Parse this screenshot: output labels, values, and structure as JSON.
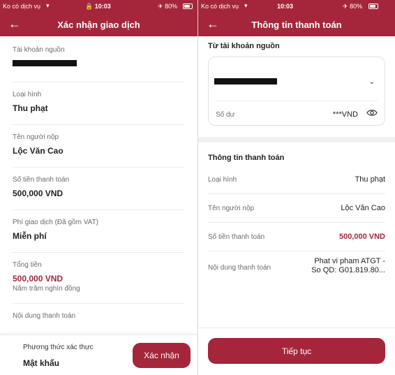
{
  "left": {
    "status": {
      "carrier": "Ko có dịch vụ",
      "time": "10:03",
      "battery": "80%",
      "battery_level": 0.8
    },
    "nav": {
      "title": "Xác nhận giao dịch"
    },
    "fields": [
      {
        "label": "Tài khoản nguồn",
        "masked": true
      },
      {
        "label": "Loại hình",
        "value": "Thu phạt"
      },
      {
        "label": "Tên người nộp",
        "value": "Lộc Văn Cao"
      },
      {
        "label": "Số tiền thanh toán",
        "value": "500,000 VND"
      },
      {
        "label": "Phí giao dịch (Đã gồm VAT)",
        "value": "Miễn phí"
      },
      {
        "label": "Tổng tiền",
        "value": "500,000 VND",
        "sub": "Năm trăm nghìn đồng"
      },
      {
        "label": "Nội dung thanh toán"
      }
    ],
    "bottom": {
      "auth_label": "Phương thức xác thực",
      "auth_value": "Mật khẩu",
      "confirm_label": "Xác nhận"
    }
  },
  "right": {
    "status": {
      "carrier": "Ko có dịch vụ",
      "time": "10:03",
      "battery": "80%",
      "battery_level": 0.8
    },
    "nav": {
      "title": "Thông tin thanh toán"
    },
    "source_title": "Từ tài khoản nguồn",
    "balance_label": "Số dư",
    "balance_value": "***VND",
    "payment_title": "Thông tin thanh toán",
    "rows": [
      {
        "label": "Loại hình",
        "value": "Thu phạt"
      },
      {
        "label": "Tên người nộp",
        "value": "Lộc Văn Cao"
      },
      {
        "label": "Số tiền thanh toán",
        "value": "500,000 VND"
      },
      {
        "label": "Nội dung thanh toán",
        "value_line1": "Phat vi pham ATGT -",
        "value_line2": "So QD: G01.819.80..."
      }
    ],
    "continue_label": "Tiếp tục"
  },
  "colors": {
    "brand": "#a5263a",
    "divider": "#ececec",
    "muted_text": "#6b6b6b"
  }
}
